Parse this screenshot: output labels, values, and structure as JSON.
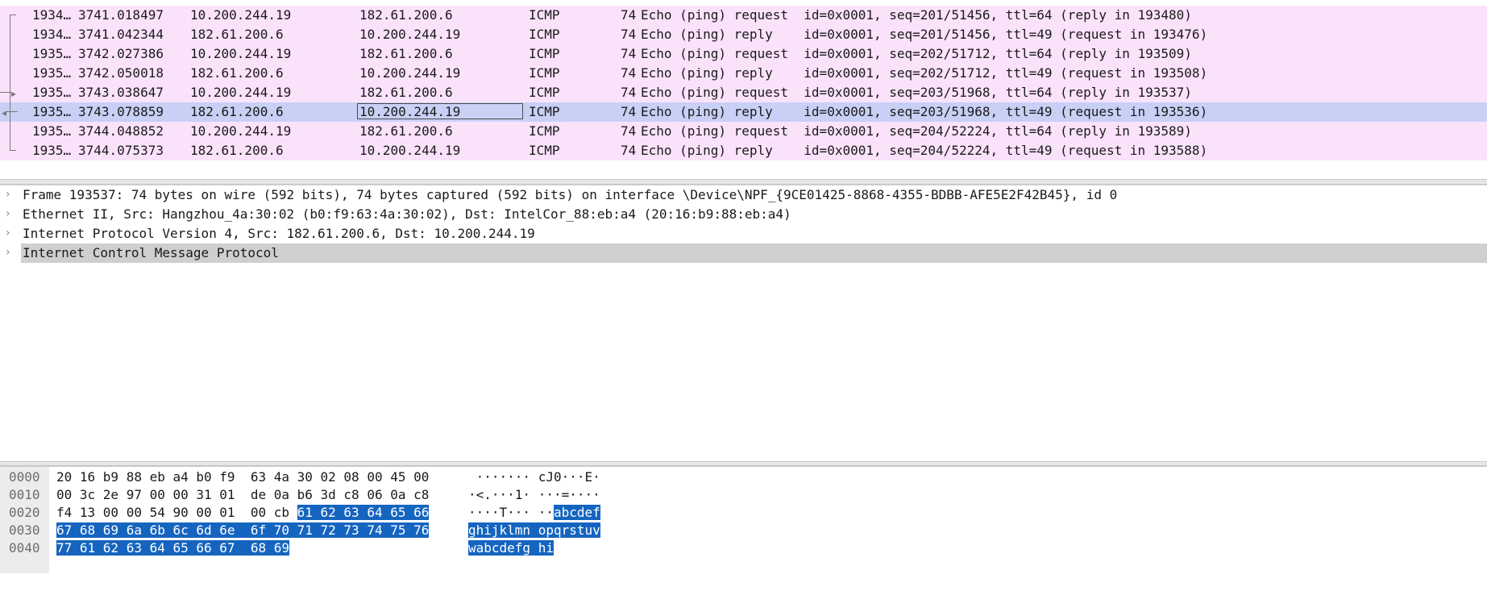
{
  "packet_list": {
    "rows": [
      {
        "no": "1934…",
        "time": "3741.018497",
        "src": "10.200.244.19",
        "dst": "182.61.200.6",
        "proto": "ICMP",
        "len": "74",
        "info": "Echo (ping) request  id=0x0001, seq=201/51456, ttl=64 (reply in 193480)"
      },
      {
        "no": "1934…",
        "time": "3741.042344",
        "src": "182.61.200.6",
        "dst": "10.200.244.19",
        "proto": "ICMP",
        "len": "74",
        "info": "Echo (ping) reply    id=0x0001, seq=201/51456, ttl=49 (request in 193476)"
      },
      {
        "no": "1935…",
        "time": "3742.027386",
        "src": "10.200.244.19",
        "dst": "182.61.200.6",
        "proto": "ICMP",
        "len": "74",
        "info": "Echo (ping) request  id=0x0001, seq=202/51712, ttl=64 (reply in 193509)"
      },
      {
        "no": "1935…",
        "time": "3742.050018",
        "src": "182.61.200.6",
        "dst": "10.200.244.19",
        "proto": "ICMP",
        "len": "74",
        "info": "Echo (ping) reply    id=0x0001, seq=202/51712, ttl=49 (request in 193508)"
      },
      {
        "no": "1935…",
        "time": "3743.038647",
        "src": "10.200.244.19",
        "dst": "182.61.200.6",
        "proto": "ICMP",
        "len": "74",
        "info": "Echo (ping) request  id=0x0001, seq=203/51968, ttl=64 (reply in 193537)"
      },
      {
        "no": "1935…",
        "time": "3743.078859",
        "src": "182.61.200.6",
        "dst": "10.200.244.19",
        "proto": "ICMP",
        "len": "74",
        "info": "Echo (ping) reply    id=0x0001, seq=203/51968, ttl=49 (request in 193536)"
      },
      {
        "no": "1935…",
        "time": "3744.048852",
        "src": "10.200.244.19",
        "dst": "182.61.200.6",
        "proto": "ICMP",
        "len": "74",
        "info": "Echo (ping) request  id=0x0001, seq=204/52224, ttl=64 (reply in 193589)"
      },
      {
        "no": "1935…",
        "time": "3744.075373",
        "src": "182.61.200.6",
        "dst": "10.200.244.19",
        "proto": "ICMP",
        "len": "74",
        "info": "Echo (ping) reply    id=0x0001, seq=204/52224, ttl=49 (request in 193588)"
      }
    ],
    "selected_index": 5,
    "row_color": "#fbe2fb",
    "selected_color": "#c8d0f5"
  },
  "details": {
    "items": [
      {
        "label": "Frame 193537: 74 bytes on wire (592 bits), 74 bytes captured (592 bits) on interface \\Device\\NPF_{9CE01425-8868-4355-BDBB-AFE5E2F42B45}, id 0",
        "expander": "chevron-right-icon"
      },
      {
        "label": "Ethernet II, Src: Hangzhou_4a:30:02 (b0:f9:63:4a:30:02), Dst: IntelCor_88:eb:a4 (20:16:b9:88:eb:a4)",
        "expander": "chevron-right-icon"
      },
      {
        "label": "Internet Protocol Version 4, Src: 182.61.200.6, Dst: 10.200.244.19",
        "expander": "chevron-right-icon"
      },
      {
        "label": "Internet Control Message Protocol",
        "expander": "chevron-right-icon"
      }
    ],
    "selected_index": 3
  },
  "bytes": {
    "highlight_color": "#1565c0",
    "rows": [
      {
        "offset": "0000",
        "hex": "20 16 b9 88 eb a4 b0 f9  63 4a 30 02 08 00 45 00",
        "hex_hl": "",
        "ascii": " ······· cJ0···E·",
        "ascii_hl": ""
      },
      {
        "offset": "0010",
        "hex": "00 3c 2e 97 00 00 31 01  de 0a b6 3d c8 06 0a c8",
        "hex_hl": "",
        "ascii": "·<.···1· ···=····",
        "ascii_hl": ""
      },
      {
        "offset": "0020",
        "hex": "f4 13 00 00 54 90 00 01  00 cb ",
        "hex_hl": "61 62 63 64 65 66",
        "ascii": "····T··· ··",
        "ascii_hl": "abcdef"
      },
      {
        "offset": "0030",
        "hex": "",
        "hex_hl": "67 68 69 6a 6b 6c 6d 6e  6f 70 71 72 73 74 75 76",
        "ascii": "",
        "ascii_hl": "ghijklmn opqrstuv"
      },
      {
        "offset": "0040",
        "hex": "",
        "hex_hl": "77 61 62 63 64 65 66 67  68 69",
        "ascii": "",
        "ascii_hl": "wabcdefg hi"
      }
    ]
  }
}
